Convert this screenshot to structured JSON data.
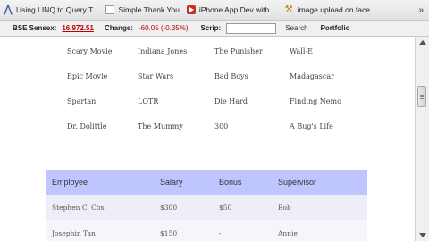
{
  "bookmarks": [
    {
      "label": "Using LINQ to Query T...",
      "icon": "linq-icon"
    },
    {
      "label": "Simple Thank You",
      "icon": "page-icon"
    },
    {
      "label": "iPhone App Dev with ...",
      "icon": "youtube-icon"
    },
    {
      "label": "image upload on face...",
      "icon": "image-icon"
    }
  ],
  "bookmarks_overflow": "»",
  "ticker": {
    "label": "BSE Sensex:",
    "value": "16,972.51",
    "change_label": "Change:",
    "change_value": "-60.05 (-0.35%)",
    "scrip_label": "Scrip:",
    "scrip_value": "",
    "search_label": "Search",
    "portfolio_label": "Portfolio",
    "negative_color": "#c00000"
  },
  "movies": [
    [
      "Scary Movie",
      "Indiana Jones",
      "The Punisher",
      "Wall-E"
    ],
    [
      "Epic Movie",
      "Star Wars",
      "Bad Boys",
      "Madagascar"
    ],
    [
      "Spartan",
      "LOTR",
      "Die Hard",
      "Finding Nemo"
    ],
    [
      "Dr. Dolittle",
      "The Mummy",
      "300",
      "A Bug's Life"
    ]
  ],
  "employee_table": {
    "headers": [
      "Employee",
      "Salary",
      "Bonus",
      "Supervisor"
    ],
    "rows": [
      [
        "Stephen C. Cox",
        "$300",
        "$50",
        "Bob"
      ],
      [
        "Josephin Tan",
        "$150",
        "-",
        "Annie"
      ]
    ],
    "header_color": "#bfc6ff"
  }
}
